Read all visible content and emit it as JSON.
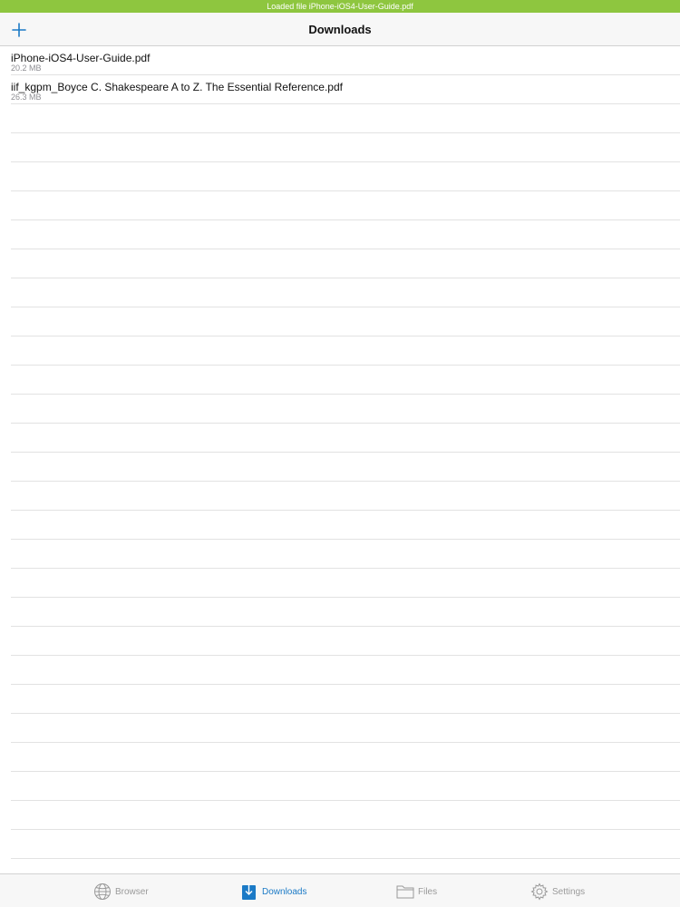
{
  "status_banner": {
    "text": "Loaded file iPhone-iOS4-User-Guide.pdf",
    "color": "#8ec63f"
  },
  "nav_bar": {
    "title": "Downloads",
    "add_icon": "plus-icon",
    "accent_color": "#1b7ac6"
  },
  "downloads": [
    {
      "name": "iPhone-iOS4-User-Guide.pdf",
      "size": "20.2 MB"
    },
    {
      "name": "iif_kgpm_Boyce C. Shakespeare A to Z. The Essential Reference.pdf",
      "size": "26.3 MB"
    }
  ],
  "tab_bar": {
    "tabs": [
      {
        "label": "Browser",
        "icon": "globe-icon",
        "active": false
      },
      {
        "label": "Downloads",
        "icon": "download-icon",
        "active": true
      },
      {
        "label": "Files",
        "icon": "folder-icon",
        "active": false
      },
      {
        "label": "Settings",
        "icon": "gear-icon",
        "active": false
      }
    ]
  }
}
